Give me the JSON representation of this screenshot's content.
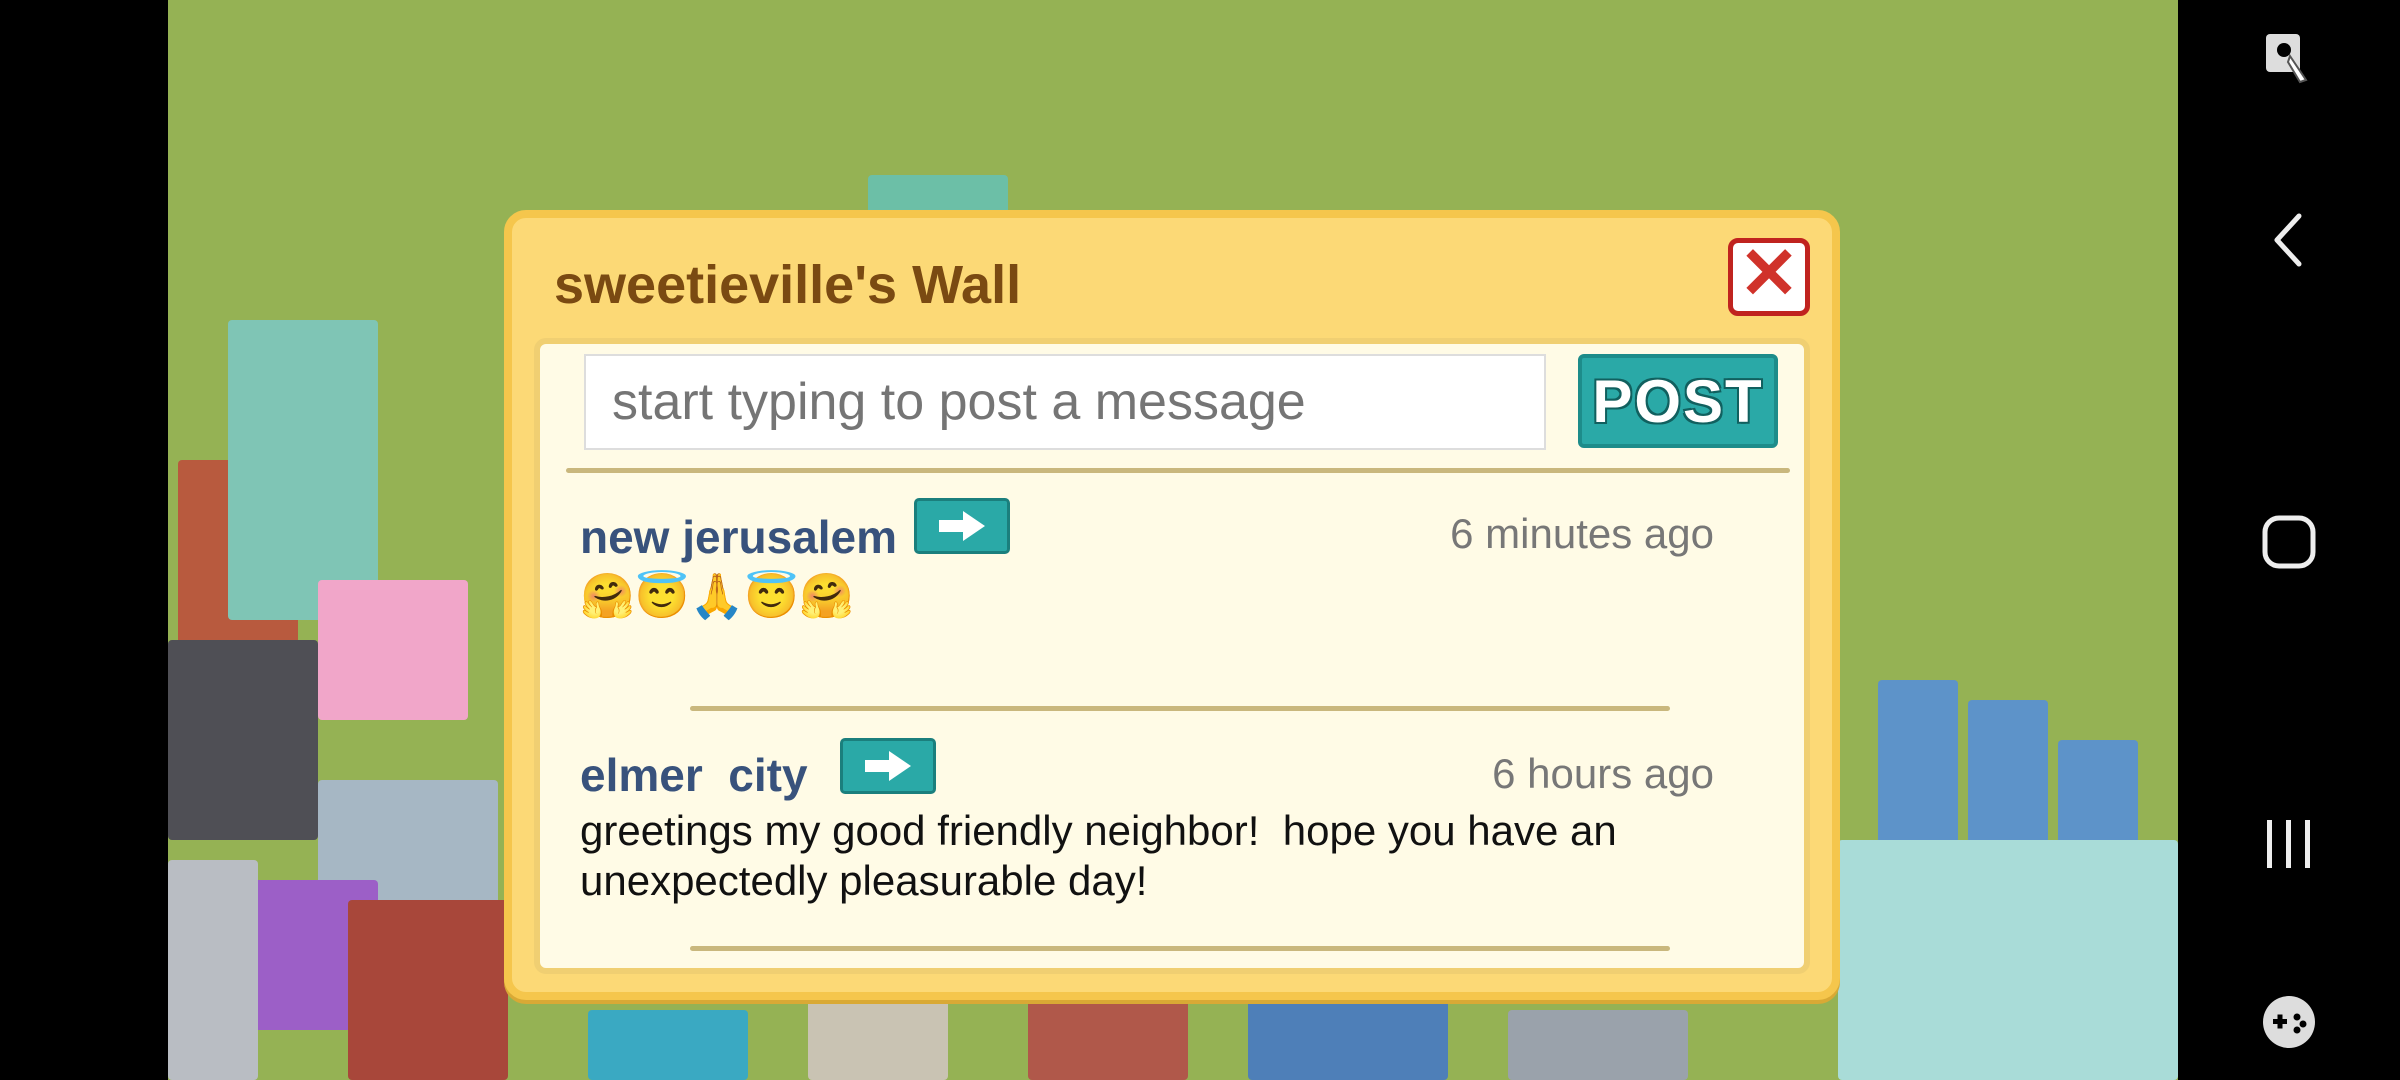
{
  "dialog": {
    "title": "sweetieville's Wall",
    "close_glyph": "✕",
    "input_placeholder": "start typing to post a message",
    "post_label": "POST"
  },
  "posts": [
    {
      "author": "new jerusalem",
      "time": "6 minutes ago",
      "body": "🤗😇🙏😇🤗"
    },
    {
      "author": "elmer  city",
      "time": "6 hours ago",
      "body_line1": "greetings my good friendly neighbor!  hope you have an",
      "body_line2": "unexpectedly pleasurable day!"
    }
  ],
  "colors": {
    "game_bg": "#95b254",
    "dialog_bg": "#fcd976",
    "accent_teal": "#2aa9a7",
    "author": "#38527c",
    "title": "#7a4a12"
  },
  "navbar": {
    "icons": [
      "screenshot-touch-icon",
      "back-icon",
      "home-icon",
      "recents-icon",
      "game-tools-icon"
    ]
  }
}
